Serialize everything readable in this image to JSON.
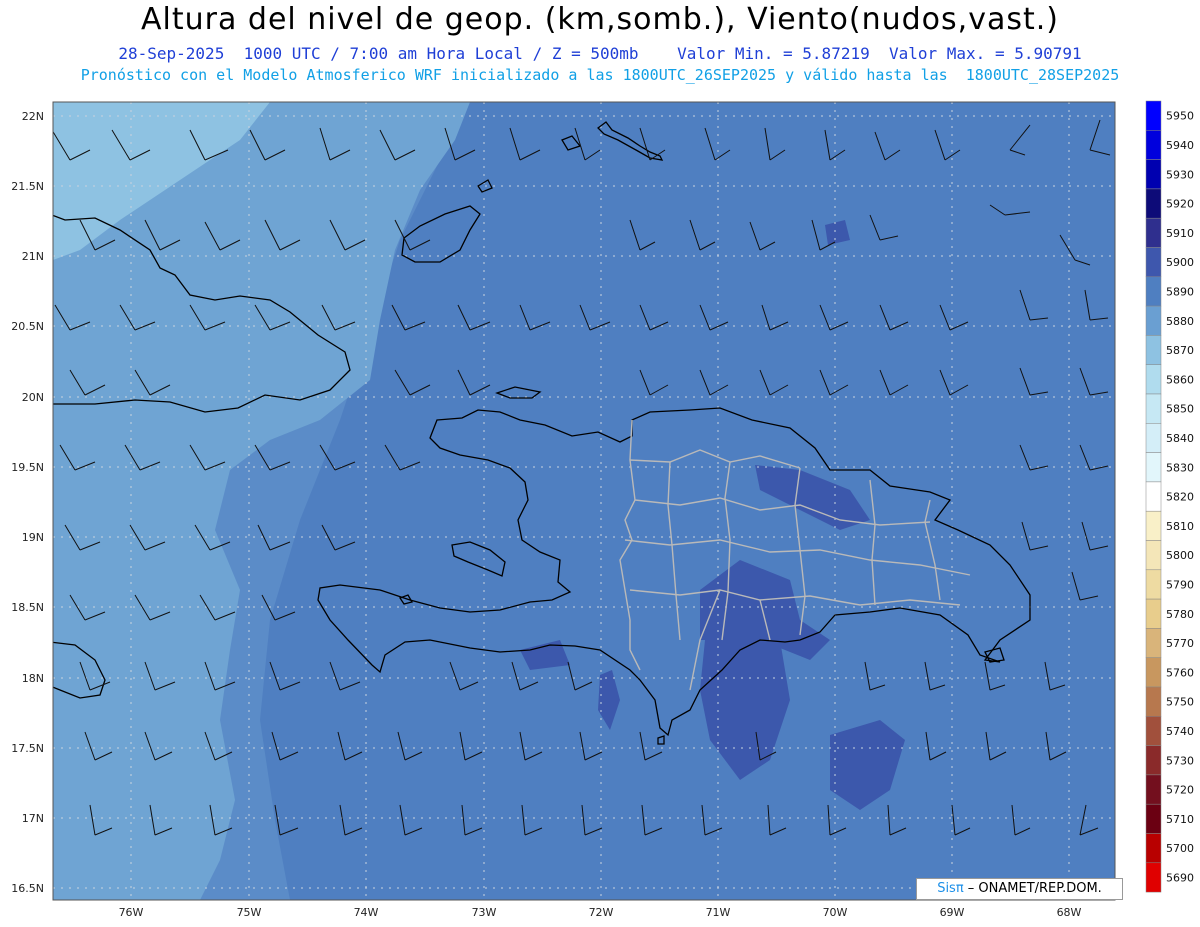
{
  "header": {
    "title": "Altura del nivel de geop. (km,somb.), Viento(nudos,vast.)",
    "subtitle_1": "28-Sep-2025  1000 UTC / 7:00 am Hora Local / Z = 500mb    Valor Min. = 5.87219  Valor Max. = 5.90791",
    "subtitle_2": "Pronóstico con el Modelo Atmosferico WRF inicializado a las 1800UTC_26SEP2025 y válido hasta las  1800UTC_28SEP2025"
  },
  "map": {
    "lat_ticks": [
      "22N",
      "21.5N",
      "21N",
      "20.5N",
      "20N",
      "19.5N",
      "19N",
      "18.5N",
      "18N",
      "17.5N",
      "17N",
      "16.5N"
    ],
    "lon_ticks": [
      "76W",
      "75W",
      "74W",
      "73W",
      "72W",
      "71W",
      "70W",
      "69W",
      "68W"
    ],
    "field_colors": {
      "light": "#8ec2e2",
      "mid_light": "#6fa4d3",
      "mid": "#5b8cc8",
      "base": "#4f7fc1",
      "dark": "#3c58ac"
    }
  },
  "colorbar": {
    "levels": [
      "5950",
      "5940",
      "5930",
      "5920",
      "5910",
      "5900",
      "5890",
      "5880",
      "5870",
      "5860",
      "5850",
      "5840",
      "5830",
      "5820",
      "5810",
      "5800",
      "5790",
      "5780",
      "5770",
      "5760",
      "5750",
      "5740",
      "5730",
      "5720",
      "5710",
      "5700",
      "5690"
    ],
    "colors": [
      "#0000ff",
      "#0000dd",
      "#0000b0",
      "#0d0b78",
      "#2f2f8e",
      "#3e57ad",
      "#4f7fc1",
      "#6a9fd2",
      "#8ec2e2",
      "#b0dcee",
      "#c6e8f4",
      "#d4eef8",
      "#e2f6fb",
      "#ffffff",
      "#f9f0c8",
      "#f4e6b8",
      "#eedba2",
      "#e8cd8c",
      "#d9b47a",
      "#c8975f",
      "#b7784e",
      "#a1503c",
      "#8a2a2a",
      "#730f1e",
      "#6b0012",
      "#b80000",
      "#e00000"
    ]
  },
  "credit": {
    "brand_a": "Sis",
    "brand_b": "π",
    "text": " – ONAMET/REP.DOM."
  }
}
